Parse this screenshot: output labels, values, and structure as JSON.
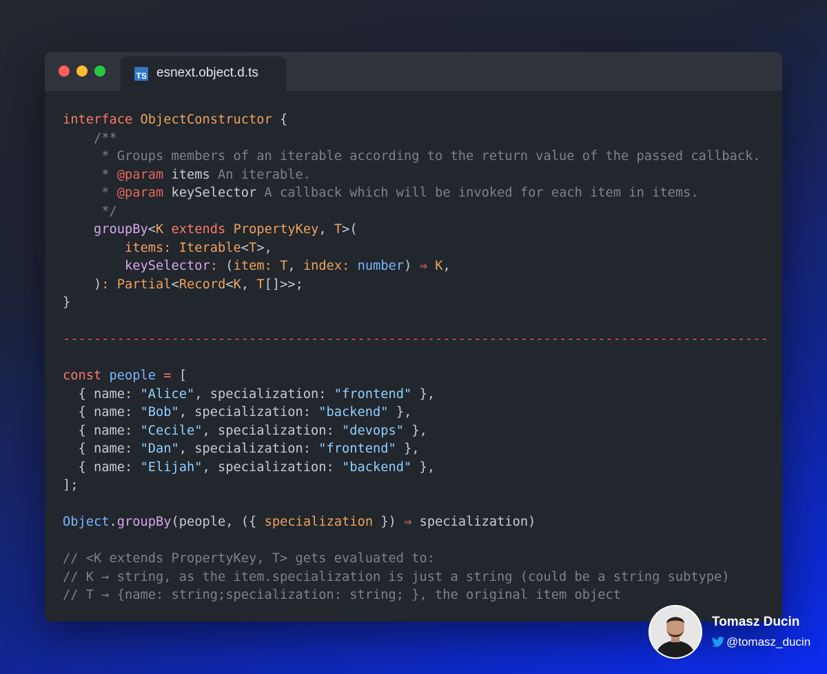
{
  "window": {
    "tab": {
      "icon_text": "TS",
      "file_name": "esnext.object.d.ts"
    }
  },
  "author": {
    "name": "Tomasz Ducin",
    "handle": "@tomasz_ducin",
    "icon": "twitter-bird-icon"
  },
  "code_lines": [
    [
      [
        "kw",
        "interface "
      ],
      [
        "typ",
        "ObjectConstructor"
      ],
      [
        "p",
        " {"
      ]
    ],
    [
      [
        "cm",
        "    /**"
      ]
    ],
    [
      [
        "cm",
        "     * Groups members of an iterable according to the return value of the passed callback."
      ]
    ],
    [
      [
        "cm",
        "     * "
      ],
      [
        "doc",
        "@param"
      ],
      [
        "p",
        " items"
      ],
      [
        "cm",
        " An iterable."
      ]
    ],
    [
      [
        "cm",
        "     * "
      ],
      [
        "doc",
        "@param"
      ],
      [
        "p",
        " keySelector"
      ],
      [
        "cm",
        " A callback which will be invoked for each item in items."
      ]
    ],
    [
      [
        "cm",
        "     */"
      ]
    ],
    [
      [
        "fn",
        "    groupBy"
      ],
      [
        "p",
        "<"
      ],
      [
        "typ",
        "K"
      ],
      [
        "kw",
        " extends "
      ],
      [
        "typ",
        "PropertyKey"
      ],
      [
        "p",
        ", "
      ],
      [
        "typ",
        "T"
      ],
      [
        "p",
        ">("
      ]
    ],
    [
      [
        "tpl",
        "        items: "
      ],
      [
        "typ",
        "Iterable"
      ],
      [
        "p",
        "<"
      ],
      [
        "typ",
        "T"
      ],
      [
        "p",
        ">,"
      ]
    ],
    [
      [
        "fn",
        "        keySelector"
      ],
      [
        "tpl",
        ": "
      ],
      [
        "p",
        "("
      ],
      [
        "tpl",
        "item: "
      ],
      [
        "typ",
        "T"
      ],
      [
        "p",
        ", "
      ],
      [
        "tpl",
        "index: "
      ],
      [
        "var",
        "number"
      ],
      [
        "p",
        ") "
      ],
      [
        "op",
        "⇒"
      ],
      [
        "p",
        " "
      ],
      [
        "typ",
        "K"
      ],
      [
        "p",
        ","
      ]
    ],
    [
      [
        "p",
        "    )"
      ],
      [
        "tpl",
        ": "
      ],
      [
        "typ",
        "Partial"
      ],
      [
        "p",
        "<"
      ],
      [
        "typ",
        "Record"
      ],
      [
        "p",
        "<"
      ],
      [
        "typ",
        "K"
      ],
      [
        "p",
        ", "
      ],
      [
        "typ",
        "T"
      ],
      [
        "p",
        "[]>>;"
      ]
    ],
    [
      [
        "p",
        "}"
      ]
    ],
    [
      [
        "p",
        ""
      ]
    ],
    [
      [
        "sep",
        "-------------------------------------------------------------------------------------------"
      ]
    ],
    [
      [
        "p",
        ""
      ]
    ],
    [
      [
        "kw",
        "const "
      ],
      [
        "var",
        "people"
      ],
      [
        "op",
        " = "
      ],
      [
        "p",
        "["
      ]
    ],
    [
      [
        "p",
        "  { name: "
      ],
      [
        "str",
        "\"Alice\""
      ],
      [
        "p",
        ", specialization: "
      ],
      [
        "str",
        "\"frontend\""
      ],
      [
        "p",
        " },"
      ]
    ],
    [
      [
        "p",
        "  { name: "
      ],
      [
        "str",
        "\"Bob\""
      ],
      [
        "p",
        ", specialization: "
      ],
      [
        "str",
        "\"backend\""
      ],
      [
        "p",
        " },"
      ]
    ],
    [
      [
        "p",
        "  { name: "
      ],
      [
        "str",
        "\"Cecile\""
      ],
      [
        "p",
        ", specialization: "
      ],
      [
        "str",
        "\"devops\""
      ],
      [
        "p",
        " },"
      ]
    ],
    [
      [
        "p",
        "  { name: "
      ],
      [
        "str",
        "\"Dan\""
      ],
      [
        "p",
        ", specialization: "
      ],
      [
        "str",
        "\"frontend\""
      ],
      [
        "p",
        " },"
      ]
    ],
    [
      [
        "p",
        "  { name: "
      ],
      [
        "str",
        "\"Elijah\""
      ],
      [
        "p",
        ", specialization: "
      ],
      [
        "str",
        "\"backend\""
      ],
      [
        "p",
        " },"
      ]
    ],
    [
      [
        "p",
        "];"
      ]
    ],
    [
      [
        "p",
        ""
      ]
    ],
    [
      [
        "var",
        "Object"
      ],
      [
        "p",
        "."
      ],
      [
        "fn",
        "groupBy"
      ],
      [
        "p",
        "(people, ({ "
      ],
      [
        "typ",
        "specialization"
      ],
      [
        "p",
        " }) "
      ],
      [
        "op",
        "⇒"
      ],
      [
        "p",
        " specialization)"
      ]
    ],
    [
      [
        "p",
        ""
      ]
    ],
    [
      [
        "cm",
        "// <K extends PropertyKey, T> gets evaluated to:"
      ]
    ],
    [
      [
        "cm",
        "// K → string, as the item.specialization is just a string (could be a string subtype)"
      ]
    ],
    [
      [
        "cm",
        "// T → {name: string;specialization: string; }, the original item object"
      ]
    ]
  ]
}
